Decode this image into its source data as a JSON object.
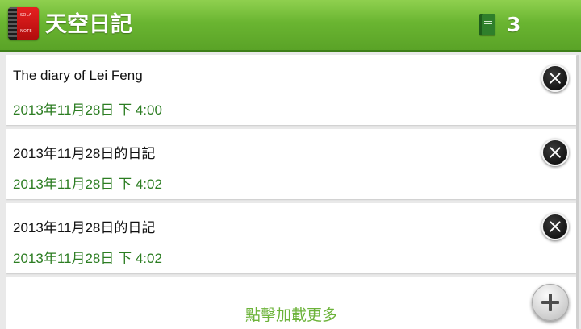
{
  "app": {
    "title": "天空日記",
    "icon_text_top": "SOLA",
    "icon_text_bottom": "NOTE",
    "diary_count": "3"
  },
  "entries": [
    {
      "title": "The diary of Lei Feng",
      "date": "2013年11月28日 下 4:00"
    },
    {
      "title": "2013年11月28日的日記",
      "date": "2013年11月28日 下 4:02"
    },
    {
      "title": "2013年11月28日的日記",
      "date": "2013年11月28日 下 4:02"
    }
  ],
  "load_more_label": "點擊加載更多",
  "icons": {
    "app": "sola-note-app-icon",
    "count": "book-icon",
    "delete": "close-circle-icon",
    "add": "add-circle-icon"
  },
  "colors": {
    "header": "#6ab531",
    "date_text": "#2c7d22",
    "load_more_text": "#6cb33a"
  }
}
